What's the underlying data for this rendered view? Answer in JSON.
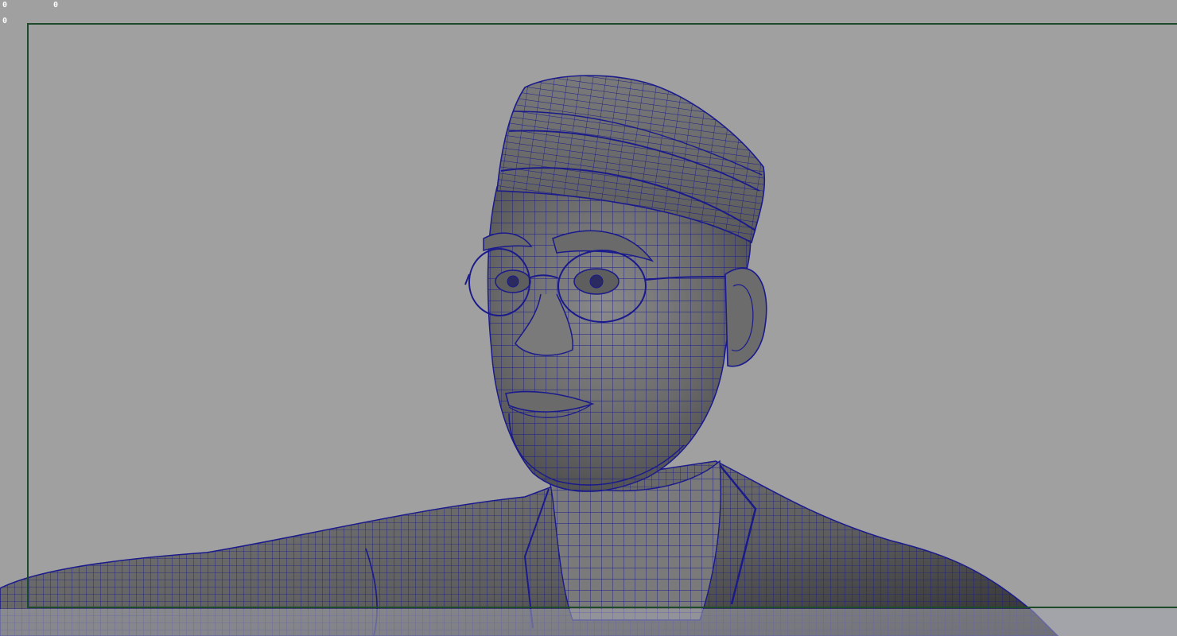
{
  "viewport": {
    "hud": {
      "counter_a": "0",
      "counter_b": "0",
      "counter_c": "0"
    },
    "background_color": "#a0a0a0",
    "gate_color": "#1e4a2c",
    "wireframe_color": "#1a1a8c",
    "shaded_color": "#6e6e6e",
    "model": {
      "subject": "bust-wireframe-mesh"
    }
  }
}
